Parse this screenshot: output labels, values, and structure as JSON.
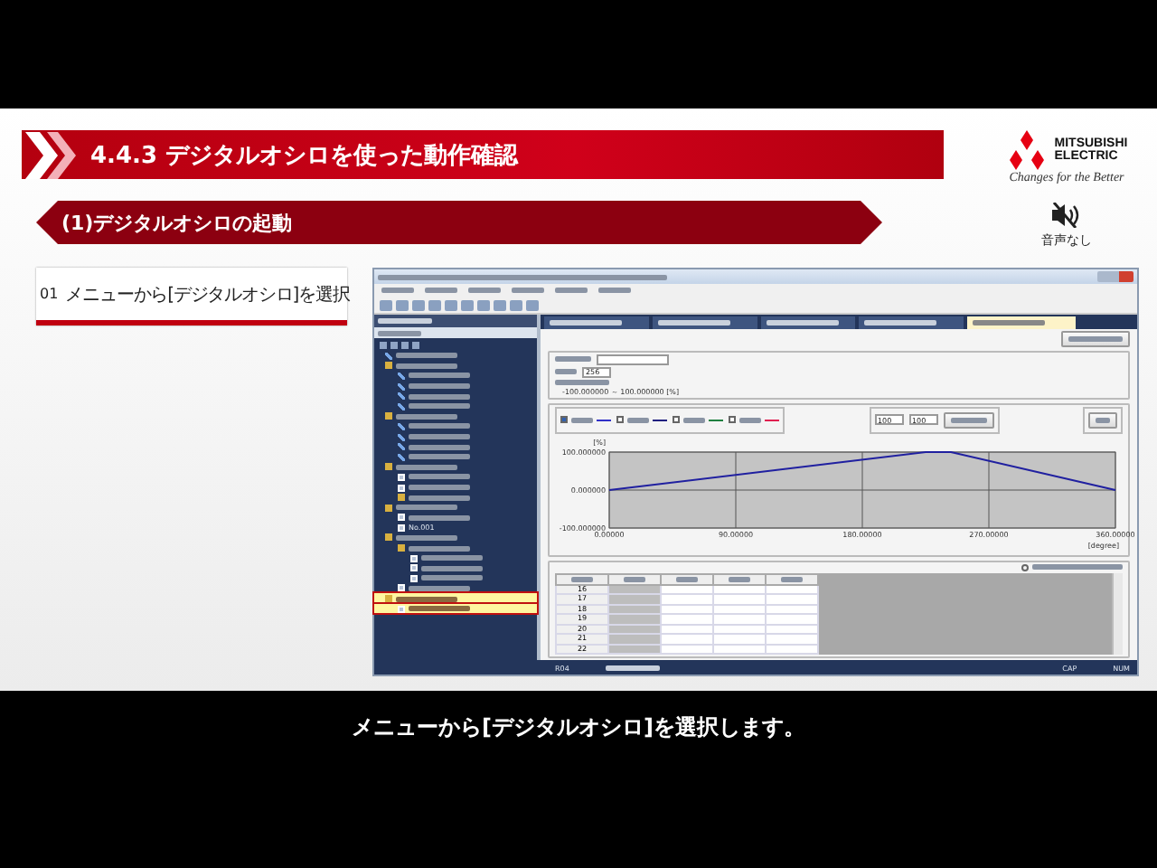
{
  "slide": {
    "title": "4.4.3 デジタルオシロを使った動作確認",
    "subtitle": "(1)デジタルオシロの起動",
    "brand": {
      "line1": "MITSUBISHI",
      "line2": "ELECTRIC",
      "tagline": "Changes for the Better"
    },
    "sound_label": "音声なし"
  },
  "step": {
    "number": "01",
    "text": "メニューから[デジタルオシロ]を選択"
  },
  "app": {
    "tree": [
      {
        "kind": "data",
        "selected": false
      },
      {
        "kind": "folder",
        "selected": false,
        "children": [
          {
            "kind": "data",
            "selected": false
          },
          {
            "kind": "data",
            "selected": false
          },
          {
            "kind": "data",
            "selected": false
          },
          {
            "kind": "data",
            "selected": false
          }
        ]
      },
      {
        "kind": "folder",
        "selected": false,
        "children": [
          {
            "kind": "data",
            "selected": false
          },
          {
            "kind": "data",
            "selected": false
          },
          {
            "kind": "data",
            "selected": false
          },
          {
            "kind": "data",
            "selected": false
          }
        ]
      },
      {
        "kind": "folder",
        "selected": false,
        "children": [
          {
            "kind": "window",
            "selected": false
          },
          {
            "kind": "window",
            "selected": false
          },
          {
            "kind": "folder",
            "selected": false
          }
        ]
      },
      {
        "kind": "folder",
        "selected": false,
        "children": [
          {
            "kind": "window",
            "selected": false
          },
          {
            "kind": "window",
            "selected": false,
            "label": "No.001"
          }
        ]
      },
      {
        "kind": "folder",
        "selected": false,
        "children": [
          {
            "kind": "folder",
            "selected": false,
            "children": [
              {
                "kind": "window",
                "selected": false
              },
              {
                "kind": "window",
                "selected": false
              },
              {
                "kind": "window",
                "selected": false
              }
            ]
          },
          {
            "kind": "window",
            "selected": false
          }
        ]
      },
      {
        "kind": "folder",
        "selected": true,
        "children": [
          {
            "kind": "window",
            "selected": true
          }
        ]
      }
    ],
    "tabs": [
      {
        "selected": false
      },
      {
        "selected": false
      },
      {
        "selected": false
      },
      {
        "selected": false
      },
      {
        "selected": true
      }
    ],
    "settings": {
      "resolution": "256",
      "range": "-100.000000 ～ 100.000000 [%]"
    },
    "zoom": {
      "horizontal": "100",
      "vertical": "100"
    },
    "legend": [
      {
        "checked": true,
        "color": "#3030c8"
      },
      {
        "checked": false,
        "color": "#202080"
      },
      {
        "checked": false,
        "color": "#208040"
      },
      {
        "checked": false,
        "color": "#e02050"
      }
    ],
    "chart_data": {
      "type": "line",
      "x": [
        0,
        225,
        243,
        360
      ],
      "series": [
        {
          "color": "#2020a0",
          "values": [
            0,
            100,
            100,
            0
          ]
        }
      ],
      "grid": true,
      "xlim": [
        0,
        360
      ],
      "ylim": [
        -100,
        100
      ],
      "xticks": [
        {
          "value": 0,
          "label": "0.00000"
        },
        {
          "value": 90,
          "label": "90.00000"
        },
        {
          "value": 180,
          "label": "180.00000"
        },
        {
          "value": 270,
          "label": "270.00000"
        },
        {
          "value": 360,
          "label": "360.00000"
        }
      ],
      "yticks": [
        {
          "value": -100,
          "label": "-100.000000"
        },
        {
          "value": 0,
          "label": "0.000000"
        },
        {
          "value": 100,
          "label": "100.000000"
        }
      ],
      "xlabel": "[degree]",
      "ylabel": "[%]"
    },
    "option": {
      "checked": false
    },
    "table": {
      "rows": [
        "16",
        "17",
        "18",
        "19",
        "20",
        "21",
        "22"
      ]
    },
    "status": {
      "cells": [
        "R04",
        "CAP",
        "NUM"
      ]
    }
  },
  "caption": "メニューから[デジタルオシロ]を選択します。"
}
